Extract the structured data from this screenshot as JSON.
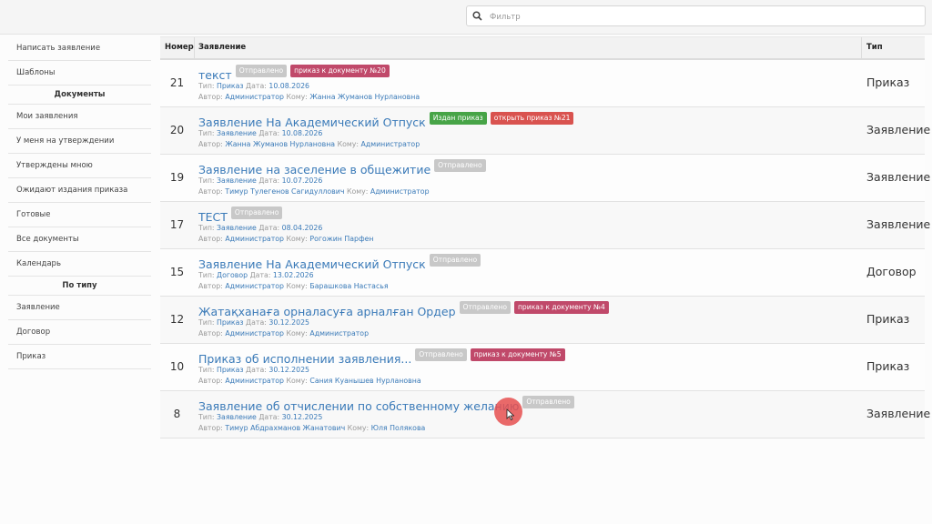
{
  "search": {
    "placeholder": "Фильтр"
  },
  "sidebar": {
    "items_top": [
      {
        "label": "Написать заявление"
      },
      {
        "label": "Шаблоны"
      }
    ],
    "header_docs": "Документы",
    "items_docs": [
      {
        "label": "Мои заявления"
      },
      {
        "label": "У меня на утверждении"
      },
      {
        "label": "Утверждены мною"
      },
      {
        "label": "Ожидают издания приказа"
      },
      {
        "label": "Готовые"
      },
      {
        "label": "Все документы"
      },
      {
        "label": "Календарь"
      }
    ],
    "header_type": "По типу",
    "items_type": [
      {
        "label": "Заявление"
      },
      {
        "label": "Договор"
      },
      {
        "label": "Приказ"
      }
    ]
  },
  "table": {
    "headers": {
      "number": "Номер",
      "doc": "Заявление",
      "type": "Тип"
    },
    "meta_labels": {
      "type": "Тип:",
      "date": "Дата:",
      "author": "Автор:",
      "to": "Кому:"
    },
    "rows": [
      {
        "number": "21",
        "title": "текст",
        "badge1": "Отправлено",
        "badge2": "приказ к документу №20",
        "doc_type": "Приказ",
        "date": "10.08.2026",
        "author": "Администратор",
        "to": "Жанна Жуманов Нурлановна",
        "type": "Приказ"
      },
      {
        "number": "20",
        "title": "Заявление На Академический Отпуск",
        "badge1": "Издан приказ",
        "badge2": "открыть приказ №21",
        "doc_type": "Заявление",
        "date": "10.08.2026",
        "author": "Жанна Жуманов Нурлановна",
        "to": "Администратор",
        "type": "Заявление"
      },
      {
        "number": "19",
        "title": "Заявление на заселение в общежитие",
        "badge1": "Отправлено",
        "badge2": "",
        "doc_type": "Заявление",
        "date": "10.07.2026",
        "author": "Тимур Тулегенов Сагидуллович",
        "to": "Администратор",
        "type": "Заявление"
      },
      {
        "number": "17",
        "title": "ТЕСТ",
        "badge1": "Отправлено",
        "badge2": "",
        "doc_type": "Заявление",
        "date": "08.04.2026",
        "author": "Администратор",
        "to": "Рогожин Парфен",
        "type": "Заявление"
      },
      {
        "number": "15",
        "title": "Заявление На Академический Отпуск",
        "badge1": "Отправлено",
        "badge2": "",
        "doc_type": "Договор",
        "date": "13.02.2026",
        "author": "Администратор",
        "to": "Барашкова Настасья",
        "type": "Договор"
      },
      {
        "number": "12",
        "title": "Жатақханаға орналасуға арналған Ордер",
        "badge1": "Отправлено",
        "badge2": "приказ к документу №4",
        "doc_type": "Приказ",
        "date": "30.12.2025",
        "author": "Администратор",
        "to": "Администратор",
        "type": "Приказ"
      },
      {
        "number": "10",
        "title": "Приказ об исполнении заявления...",
        "badge1": "Отправлено",
        "badge2": "приказ к документу №5",
        "doc_type": "Приказ",
        "date": "30.12.2025",
        "author": "Администратор",
        "to": "Сания Куанышев Нурлановна",
        "type": "Приказ"
      },
      {
        "number": "8",
        "title": "Заявление об отчислении по собственному желанию",
        "badge1": "Отправлено",
        "badge2": "",
        "doc_type": "Заявление",
        "date": "30.12.2025",
        "author": "Тимур Абдрахманов Жанатович",
        "to": "Юля Полякова",
        "type": "Заявление"
      }
    ]
  },
  "colors": {
    "link": "#3a7ab8",
    "badge_grey": "#c8c8c8",
    "badge_red": "#c0496a",
    "badge_green": "#47a447",
    "badge_red_bright": "#d9534f"
  },
  "icons": {
    "search": "search-icon",
    "cursor": "mouse-cursor-icon"
  }
}
